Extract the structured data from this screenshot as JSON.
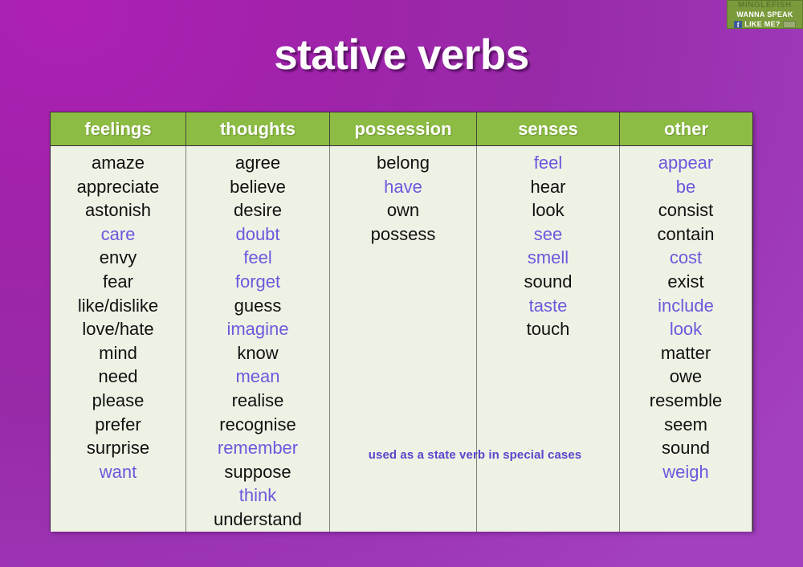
{
  "brand": {
    "line1": "MINGLEFISH",
    "line2": "WANNA SPEAK",
    "line3": "LIKE ME?",
    "facebook_glyph": "f"
  },
  "title": "stative verbs",
  "colors": {
    "background_purple": "#a41caa",
    "background_purple_light": "#a340bf",
    "header_green": "#8cbc43",
    "cell_background": "#eef2e5",
    "word_default": "#111111",
    "word_highlight": "#6a59dd",
    "footnote": "#5b45cc"
  },
  "table": {
    "headers": [
      "feelings",
      "thoughts",
      "possession",
      "senses",
      "other"
    ],
    "columns": [
      {
        "header": "feelings",
        "words": [
          {
            "text": "amaze",
            "highlight": false
          },
          {
            "text": "appreciate",
            "highlight": false
          },
          {
            "text": "astonish",
            "highlight": false
          },
          {
            "text": "care",
            "highlight": true
          },
          {
            "text": "envy",
            "highlight": false
          },
          {
            "text": "fear",
            "highlight": false
          },
          {
            "text": "like/dislike",
            "highlight": false
          },
          {
            "text": "love/hate",
            "highlight": false
          },
          {
            "text": "mind",
            "highlight": false
          },
          {
            "text": "need",
            "highlight": false
          },
          {
            "text": "please",
            "highlight": false
          },
          {
            "text": "prefer",
            "highlight": false
          },
          {
            "text": "surprise",
            "highlight": false
          },
          {
            "text": "want",
            "highlight": true
          }
        ]
      },
      {
        "header": "thoughts",
        "words": [
          {
            "text": "agree",
            "highlight": false
          },
          {
            "text": "believe",
            "highlight": false
          },
          {
            "text": "desire",
            "highlight": false
          },
          {
            "text": "doubt",
            "highlight": true
          },
          {
            "text": "feel",
            "highlight": true
          },
          {
            "text": "forget",
            "highlight": true
          },
          {
            "text": "guess",
            "highlight": false
          },
          {
            "text": "imagine",
            "highlight": true
          },
          {
            "text": "know",
            "highlight": false
          },
          {
            "text": "mean",
            "highlight": true
          },
          {
            "text": "realise",
            "highlight": false
          },
          {
            "text": "recognise",
            "highlight": false
          },
          {
            "text": "remember",
            "highlight": true
          },
          {
            "text": "suppose",
            "highlight": false
          },
          {
            "text": "think",
            "highlight": true
          },
          {
            "text": "understand",
            "highlight": false
          }
        ]
      },
      {
        "header": "possession",
        "words": [
          {
            "text": "belong",
            "highlight": false
          },
          {
            "text": "have",
            "highlight": true
          },
          {
            "text": "own",
            "highlight": false
          },
          {
            "text": "possess",
            "highlight": false
          }
        ]
      },
      {
        "header": "senses",
        "words": [
          {
            "text": "feel",
            "highlight": true
          },
          {
            "text": "hear",
            "highlight": false
          },
          {
            "text": "look",
            "highlight": false
          },
          {
            "text": "see",
            "highlight": true
          },
          {
            "text": "smell",
            "highlight": true
          },
          {
            "text": "sound",
            "highlight": false
          },
          {
            "text": "taste",
            "highlight": true
          },
          {
            "text": "touch",
            "highlight": false
          }
        ]
      },
      {
        "header": "other",
        "words": [
          {
            "text": "appear",
            "highlight": true
          },
          {
            "text": "be",
            "highlight": true
          },
          {
            "text": "consist",
            "highlight": false
          },
          {
            "text": "contain",
            "highlight": false
          },
          {
            "text": "cost",
            "highlight": true
          },
          {
            "text": "exist",
            "highlight": false
          },
          {
            "text": "include",
            "highlight": true
          },
          {
            "text": "look",
            "highlight": true
          },
          {
            "text": "matter",
            "highlight": false
          },
          {
            "text": "owe",
            "highlight": false
          },
          {
            "text": "resemble",
            "highlight": false
          },
          {
            "text": "seem",
            "highlight": false
          },
          {
            "text": "sound",
            "highlight": false
          },
          {
            "text": "weigh",
            "highlight": true
          }
        ]
      }
    ],
    "footnote": "used as a state verb in special cases"
  }
}
